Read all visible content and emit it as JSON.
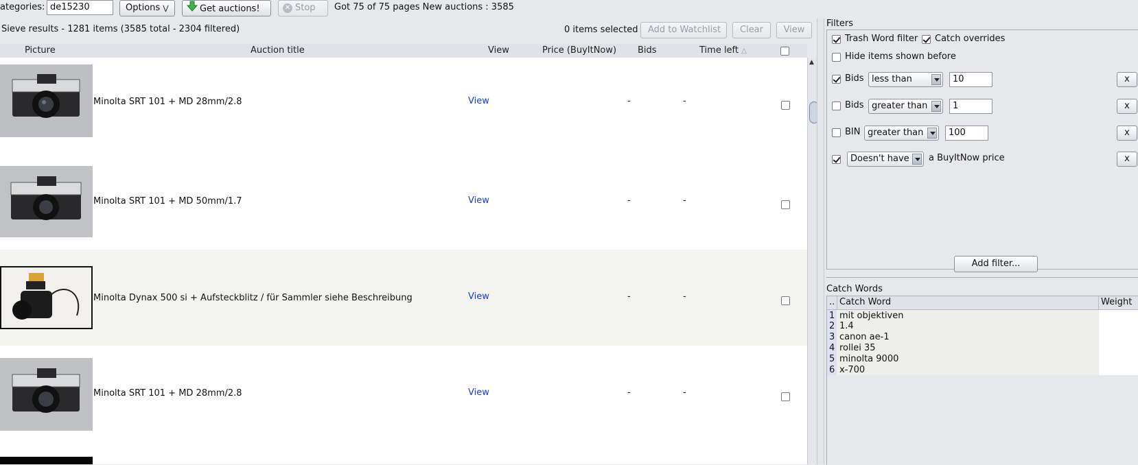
{
  "toolbar": {
    "categories_label": "ategories:",
    "categories_value": "de15230",
    "options_label": "Options",
    "get_label": "Get auctions!",
    "stop_label": "Stop",
    "status": "Got 75 of 75 pages New auctions : 3585"
  },
  "results": {
    "summary": "Sieve results - 1281 items (3585 total - 2304 filtered)",
    "selected": "0 items selected",
    "add_watchlist": "Add to Watchlist",
    "clear": "Clear",
    "view": "View",
    "columns": {
      "picture": "Picture",
      "title": "Auction title",
      "view": "View",
      "price": "Price (BuyItNow)",
      "bids": "Bids",
      "time_left": "Time left"
    },
    "rows": [
      {
        "title": "Minolta SRT 101 + MD 28mm/2.8",
        "view": "View",
        "bids": "-",
        "time_left": "-"
      },
      {
        "title": "Minolta SRT 101 + MD 50mm/1.7",
        "view": "View",
        "bids": "-",
        "time_left": "-"
      },
      {
        "title": "Minolta Dynax 500 si + Aufsteckblitz / für Sammler siehe Beschreibung",
        "view": "View",
        "bids": "-",
        "time_left": "-"
      },
      {
        "title": "Minolta SRT 101 + MD 28mm/2.8",
        "view": "View",
        "bids": "-",
        "time_left": "-"
      }
    ]
  },
  "filters": {
    "title": "Filters",
    "trash_word": "Trash Word filter",
    "catch_overrides": "Catch overrides",
    "hide_shown": "Hide items shown before",
    "rules": [
      {
        "field": "Bids",
        "op": "less than",
        "value": "10",
        "checked": true
      },
      {
        "field": "Bids",
        "op": "greater than",
        "value": "1",
        "checked": false
      },
      {
        "field": "BIN",
        "op": "greater than",
        "value": "100",
        "checked": false
      }
    ],
    "bin_rule": {
      "op": "Doesn't have",
      "suffix": "a BuyItNow price"
    },
    "remove_label": "x",
    "add_filter": "Add filter..."
  },
  "catch_words": {
    "title": "Catch Words",
    "col_num": "..",
    "col_word": "Catch Word",
    "col_weight": "Weight",
    "items": [
      {
        "n": "1",
        "word": "mit objektiven"
      },
      {
        "n": "2",
        "word": "1.4"
      },
      {
        "n": "3",
        "word": "canon ae-1"
      },
      {
        "n": "4",
        "word": "rollei 35"
      },
      {
        "n": "5",
        "word": "minolta 9000"
      },
      {
        "n": "6",
        "word": "x-700"
      }
    ]
  },
  "colors": {
    "link": "#1a3bd8",
    "header_bg": "#dfe2e7",
    "alt_row": "#f3f4f0",
    "number_bg": "#dde1f3"
  }
}
